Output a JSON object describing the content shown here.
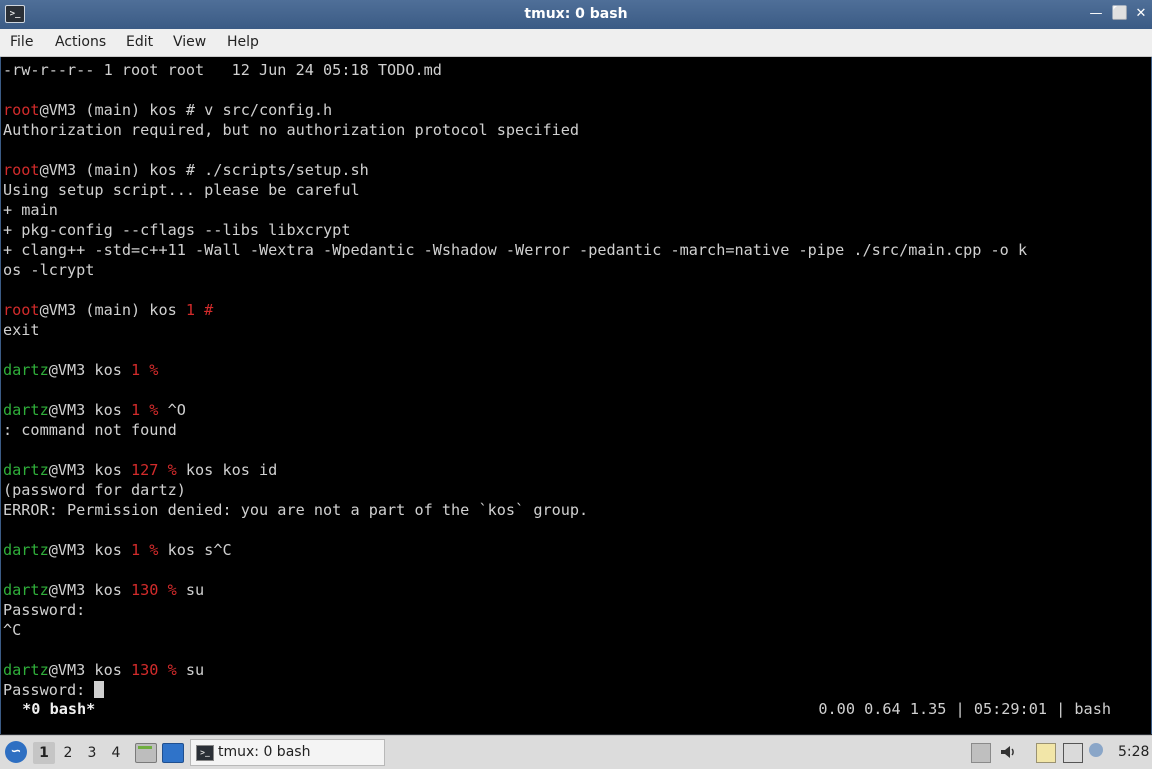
{
  "window": {
    "title": "tmux: 0 bash",
    "app_icon": ">_",
    "minimize": "—",
    "maximize": "⬜",
    "close": "✕"
  },
  "menu": [
    "File",
    "Actions",
    "Edit",
    "View",
    "Help"
  ],
  "terminal": {
    "lines": [
      [
        {
          "t": "-rw-r--r-- 1 root root   12 Jun 24 05:18 TODO.md"
        }
      ],
      [],
      [
        {
          "t": "root",
          "c": "red"
        },
        {
          "t": "@VM3 (main) kos # v src/config.h"
        }
      ],
      [
        {
          "t": "Authorization required, but no authorization protocol specified"
        }
      ],
      [],
      [
        {
          "t": "root",
          "c": "red"
        },
        {
          "t": "@VM3 (main) kos # ./scripts/setup.sh"
        }
      ],
      [
        {
          "t": "Using setup script... please be careful"
        }
      ],
      [
        {
          "t": "+ main"
        }
      ],
      [
        {
          "t": "+ pkg-config --cflags --libs libxcrypt"
        }
      ],
      [
        {
          "t": "+ clang++ -std=c++11 -Wall -Wextra -Wpedantic -Wshadow -Werror -pedantic -march=native -pipe ./src/main.cpp -o k"
        }
      ],
      [
        {
          "t": "os -lcrypt"
        }
      ],
      [],
      [
        {
          "t": "root",
          "c": "red"
        },
        {
          "t": "@VM3 (main) kos "
        },
        {
          "t": "1 #",
          "c": "red"
        }
      ],
      [
        {
          "t": "exit"
        }
      ],
      [],
      [
        {
          "t": "dartz",
          "c": "green"
        },
        {
          "t": "@VM3 kos "
        },
        {
          "t": "1 %",
          "c": "red"
        }
      ],
      [],
      [
        {
          "t": "dartz",
          "c": "green"
        },
        {
          "t": "@VM3 kos "
        },
        {
          "t": "1 %",
          "c": "red"
        },
        {
          "t": " ^O"
        }
      ],
      [
        {
          "t": ": command not found"
        }
      ],
      [],
      [
        {
          "t": "dartz",
          "c": "green"
        },
        {
          "t": "@VM3 kos "
        },
        {
          "t": "127 %",
          "c": "red"
        },
        {
          "t": " kos kos id"
        }
      ],
      [
        {
          "t": "(password for dartz)"
        }
      ],
      [
        {
          "t": "ERROR: Permission denied: you are not a part of the `kos` group."
        }
      ],
      [],
      [
        {
          "t": "dartz",
          "c": "green"
        },
        {
          "t": "@VM3 kos "
        },
        {
          "t": "1 %",
          "c": "red"
        },
        {
          "t": " kos s^C"
        }
      ],
      [],
      [
        {
          "t": "dartz",
          "c": "green"
        },
        {
          "t": "@VM3 kos "
        },
        {
          "t": "130 %",
          "c": "red"
        },
        {
          "t": " su"
        }
      ],
      [
        {
          "t": "Password:"
        }
      ],
      [
        {
          "t": "^C"
        }
      ],
      [],
      [
        {
          "t": "dartz",
          "c": "green"
        },
        {
          "t": "@VM3 kos "
        },
        {
          "t": "130 %",
          "c": "red"
        },
        {
          "t": " su"
        }
      ],
      [
        {
          "t": "Password: "
        },
        {
          "cursor": true
        }
      ]
    ],
    "status_left": " *0 bash*",
    "status_right": "0.00 0.64 1.35 | 05:29:01 | bash"
  },
  "taskbar": {
    "start_icon": "start-menu-icon",
    "workspaces": [
      "1",
      "2",
      "3",
      "4"
    ],
    "active_workspace": "1",
    "task_label": "tmux: 0 bash",
    "clock": "5:28"
  },
  "colors": {
    "prompt_root": "#d22b2b",
    "prompt_user": "#2fae3a",
    "titlebar": "#3b5b85"
  }
}
